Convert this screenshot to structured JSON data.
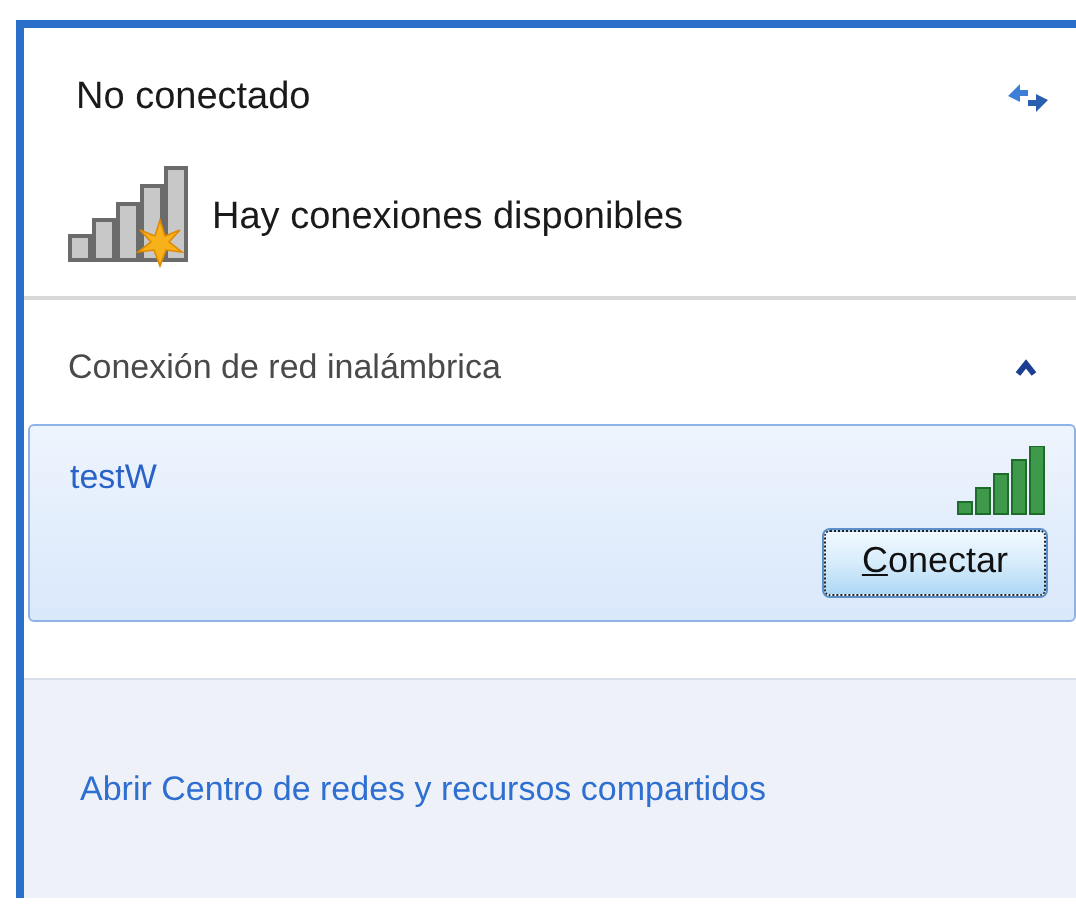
{
  "status": {
    "title": "No conectado",
    "message": "Hay conexiones disponibles"
  },
  "section": {
    "title": "Conexión de red inalámbrica",
    "expanded": true
  },
  "networks": [
    {
      "name": "testW",
      "selected": true,
      "button": "Conectar"
    }
  ],
  "footer_link": "Abrir Centro de redes y recursos compartidos"
}
